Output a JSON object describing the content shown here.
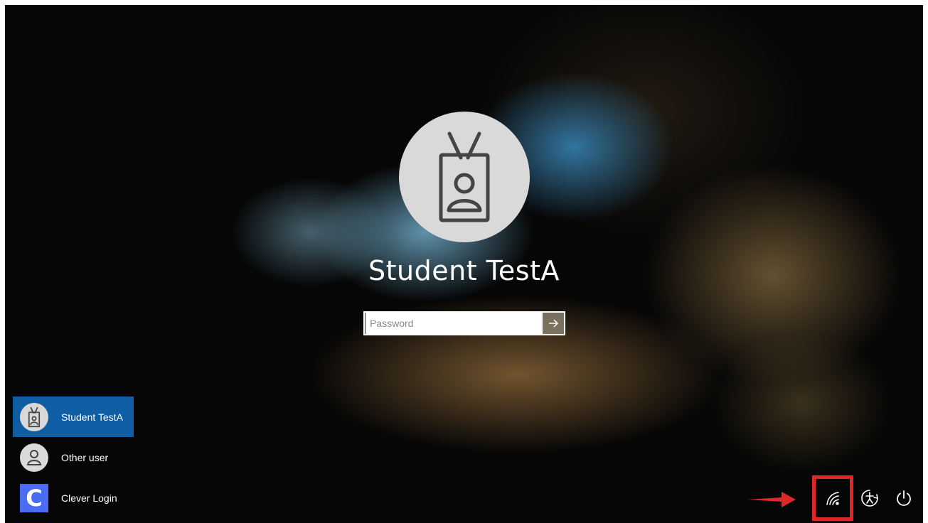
{
  "lock_screen": {
    "selected_user_name": "Student TestA",
    "password_placeholder": "Password",
    "password_value": ""
  },
  "user_list": [
    {
      "label": "Student TestA",
      "icon": "badge-user-icon",
      "selected": true
    },
    {
      "label": "Other user",
      "icon": "person-icon",
      "selected": false
    },
    {
      "label": "Clever Login",
      "icon": "clever-logo",
      "selected": false
    }
  ],
  "clever_letter": "C",
  "tray_icons": [
    "network-icon",
    "ease-of-access-icon",
    "power-icon"
  ],
  "annotation": {
    "highlight_color": "#e02727",
    "highlighted_item": "network-icon"
  },
  "colors": {
    "selected_user_bg": "#0f5da3",
    "avatar_bg": "#d9d9d9",
    "clever_blue": "#4a6cf2"
  }
}
